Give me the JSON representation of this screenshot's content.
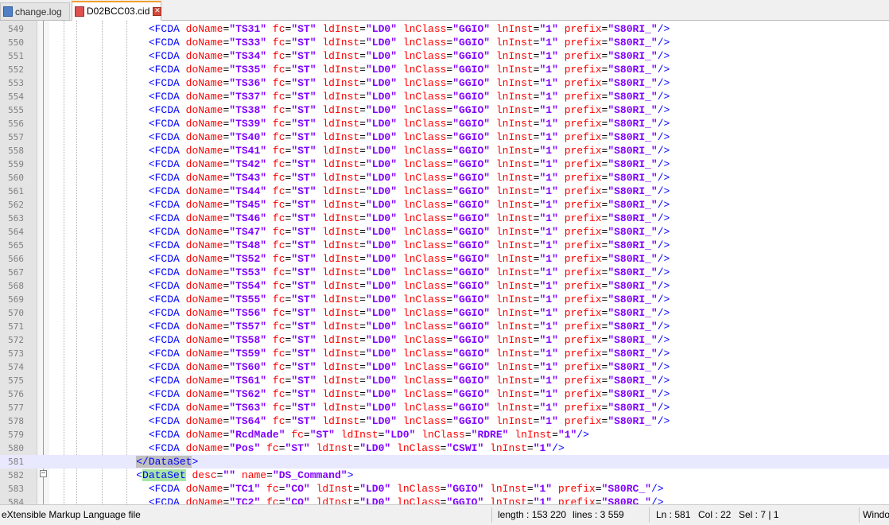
{
  "tabs": [
    {
      "name": "change.log",
      "active": false
    },
    {
      "name": "D02BCC03.cid",
      "active": true
    }
  ],
  "editor": {
    "lines": [
      {
        "n": "549",
        "s": "TS31"
      },
      {
        "n": "550",
        "s": "TS33"
      },
      {
        "n": "551",
        "s": "TS34"
      },
      {
        "n": "552",
        "s": "TS35"
      },
      {
        "n": "553",
        "s": "TS36"
      },
      {
        "n": "554",
        "s": "TS37"
      },
      {
        "n": "555",
        "s": "TS38"
      },
      {
        "n": "556",
        "s": "TS39"
      },
      {
        "n": "557",
        "s": "TS40"
      },
      {
        "n": "558",
        "s": "TS41"
      },
      {
        "n": "559",
        "s": "TS42"
      },
      {
        "n": "560",
        "s": "TS43"
      },
      {
        "n": "561",
        "s": "TS44"
      },
      {
        "n": "562",
        "s": "TS45"
      },
      {
        "n": "563",
        "s": "TS46"
      },
      {
        "n": "564",
        "s": "TS47"
      },
      {
        "n": "565",
        "s": "TS48"
      },
      {
        "n": "566",
        "s": "TS52"
      },
      {
        "n": "567",
        "s": "TS53"
      },
      {
        "n": "568",
        "s": "TS54"
      },
      {
        "n": "569",
        "s": "TS55"
      },
      {
        "n": "570",
        "s": "TS56"
      },
      {
        "n": "571",
        "s": "TS57"
      },
      {
        "n": "572",
        "s": "TS58"
      },
      {
        "n": "573",
        "s": "TS59"
      },
      {
        "n": "574",
        "s": "TS60"
      },
      {
        "n": "575",
        "s": "TS61"
      },
      {
        "n": "576",
        "s": "TS62"
      },
      {
        "n": "577",
        "s": "TS63"
      },
      {
        "n": "578",
        "s": "TS64"
      },
      {
        "n": "579",
        "t": "fcda",
        "attrs": [
          [
            "doName",
            "RcdMade"
          ],
          [
            "fc",
            "ST"
          ],
          [
            "ldInst",
            "LD0"
          ],
          [
            "lnClass",
            "RDRE"
          ],
          [
            "lnInst",
            "1"
          ]
        ]
      },
      {
        "n": "580",
        "t": "fcda",
        "attrs": [
          [
            "doName",
            "Pos"
          ],
          [
            "fc",
            "ST"
          ],
          [
            "ldInst",
            "LD0"
          ],
          [
            "lnClass",
            "CSWI"
          ],
          [
            "lnInst",
            "1"
          ]
        ]
      },
      {
        "n": "581",
        "t": "close",
        "name": "DataSet"
      },
      {
        "n": "582",
        "t": "open",
        "name": "DataSet",
        "attrs": [
          [
            "desc",
            ""
          ],
          [
            "name",
            "DS_Command"
          ]
        ]
      },
      {
        "n": "583",
        "t": "fcda",
        "attrs": [
          [
            "doName",
            "TC1"
          ],
          [
            "fc",
            "CO"
          ],
          [
            "ldInst",
            "LD0"
          ],
          [
            "lnClass",
            "GGIO"
          ],
          [
            "lnInst",
            "1"
          ],
          [
            "prefix",
            "S80RC_"
          ]
        ]
      },
      {
        "n": "584",
        "t": "fcda",
        "attrs": [
          [
            "doName",
            "TC2"
          ],
          [
            "fc",
            "CO"
          ],
          [
            "ldInst",
            "LD0"
          ],
          [
            "lnClass",
            "GGIO"
          ],
          [
            "lnInst",
            "1"
          ],
          [
            "prefix",
            "S80RC_"
          ]
        ]
      }
    ]
  },
  "status": {
    "file_type": "eXtensible Markup Language file",
    "length": "length : 153 220",
    "lines": "lines : 3 559",
    "ln": "Ln : 581",
    "col": "Col : 22",
    "sel": "Sel : 7 | 1",
    "eol": "Windo"
  }
}
